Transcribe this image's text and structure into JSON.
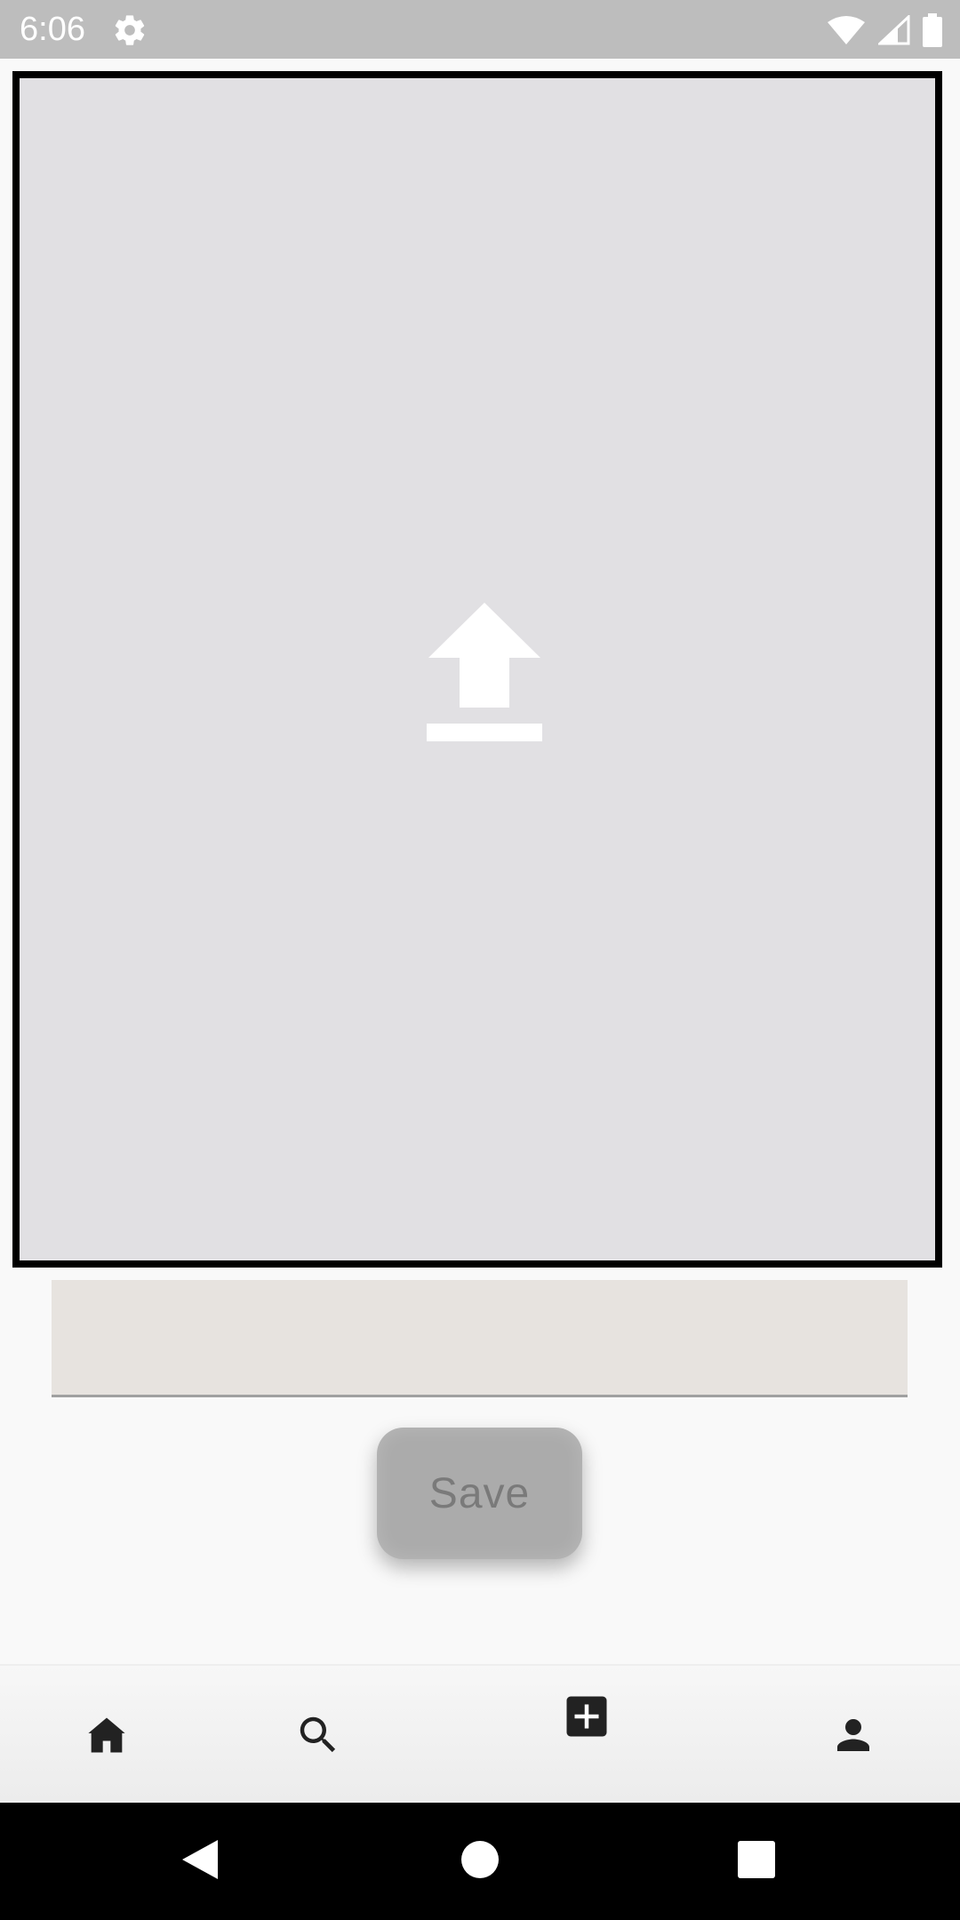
{
  "status_bar": {
    "time": "6:06",
    "icons": [
      "gear-icon",
      "wifi-icon",
      "cell-signal-icon",
      "battery-icon"
    ],
    "background": "#bdbdbd"
  },
  "upload_panel": {
    "icon": "upload-icon",
    "background": "#e1e0e3",
    "border_color": "#000000"
  },
  "caption_input": {
    "value": "",
    "placeholder": "",
    "background": "#e7e3df"
  },
  "save_button": {
    "label": "Save",
    "background": "#ababab",
    "text_color": "#7a7a7a"
  },
  "bottom_nav": {
    "items": [
      {
        "name": "home",
        "icon": "home-icon"
      },
      {
        "name": "search",
        "icon": "search-icon"
      },
      {
        "name": "add",
        "icon": "add-box-icon"
      },
      {
        "name": "profile",
        "icon": "person-icon"
      }
    ]
  },
  "system_nav": {
    "buttons": [
      "back-icon",
      "home-circle-icon",
      "recents-icon"
    ]
  }
}
